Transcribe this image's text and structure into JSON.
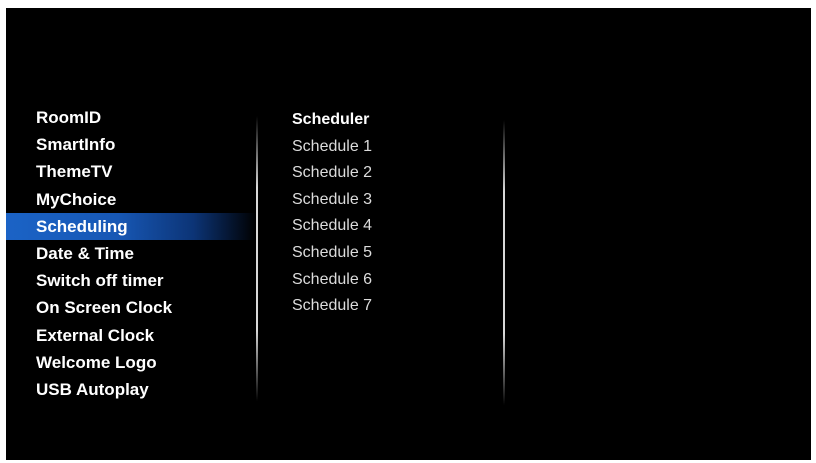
{
  "menu": {
    "items": [
      {
        "label": "RoomID"
      },
      {
        "label": "SmartInfo"
      },
      {
        "label": "ThemeTV"
      },
      {
        "label": "MyChoice"
      },
      {
        "label": "Scheduling",
        "selected": true
      },
      {
        "label": "Date & Time"
      },
      {
        "label": "Switch off timer"
      },
      {
        "label": "On Screen Clock"
      },
      {
        "label": "External Clock"
      },
      {
        "label": "Welcome Logo"
      },
      {
        "label": "USB Autoplay"
      }
    ]
  },
  "submenu": {
    "title": "Scheduler",
    "items": [
      {
        "label": "Schedule 1"
      },
      {
        "label": "Schedule 2"
      },
      {
        "label": "Schedule 3"
      },
      {
        "label": "Schedule 4"
      },
      {
        "label": "Schedule 5"
      },
      {
        "label": "Schedule 6"
      },
      {
        "label": "Schedule 7"
      }
    ]
  },
  "colors": {
    "background": "#000000",
    "selection": "#1b63c6",
    "text": "#ffffff"
  }
}
